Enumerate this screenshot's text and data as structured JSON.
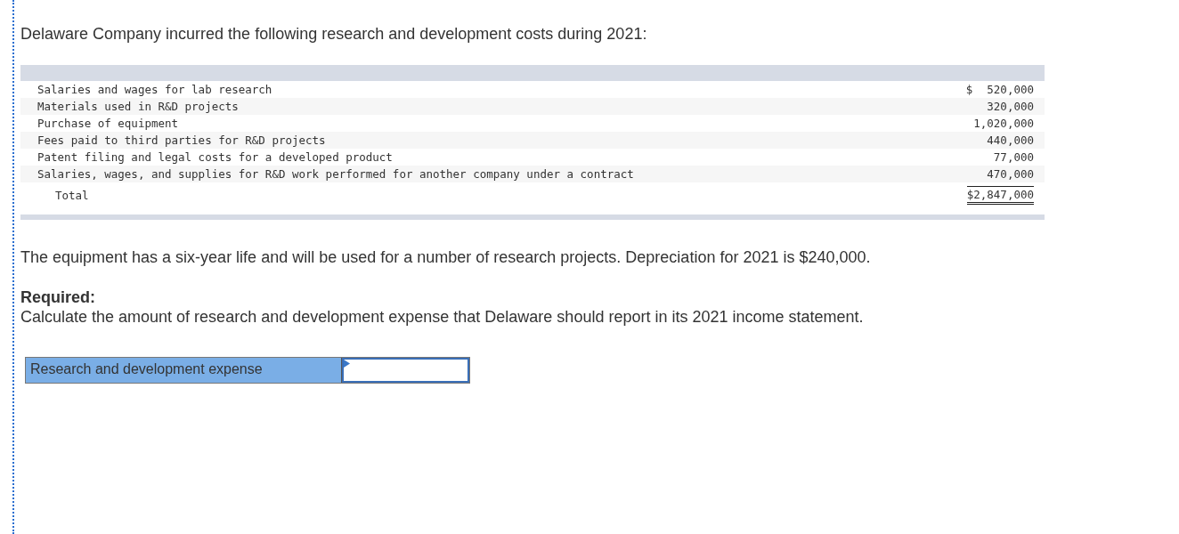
{
  "intro": "Delaware Company incurred the following research and development costs during 2021:",
  "table": {
    "rows": [
      {
        "label": "Salaries and wages for lab research",
        "currency": "$",
        "amount": "520,000"
      },
      {
        "label": "Materials used in R&D projects",
        "amount": "320,000"
      },
      {
        "label": "Purchase of equipment",
        "amount": "1,020,000"
      },
      {
        "label": "Fees paid to third parties for R&D projects",
        "amount": "440,000"
      },
      {
        "label": "Patent filing and legal costs for a developed product",
        "amount": "77,000"
      },
      {
        "label": "Salaries, wages, and supplies for R&D work performed for another company under a contract",
        "amount": "470,000"
      }
    ],
    "total": {
      "label": "Total",
      "amount": "$2,847,000"
    }
  },
  "note": "The equipment has a six-year life and will be used for a number of research projects. Depreciation for 2021 is $240,000.",
  "required": {
    "heading": "Required:",
    "text": "Calculate the amount of research and development expense that Delaware should report in its 2021 income statement."
  },
  "answer": {
    "label": "Research and development expense"
  }
}
